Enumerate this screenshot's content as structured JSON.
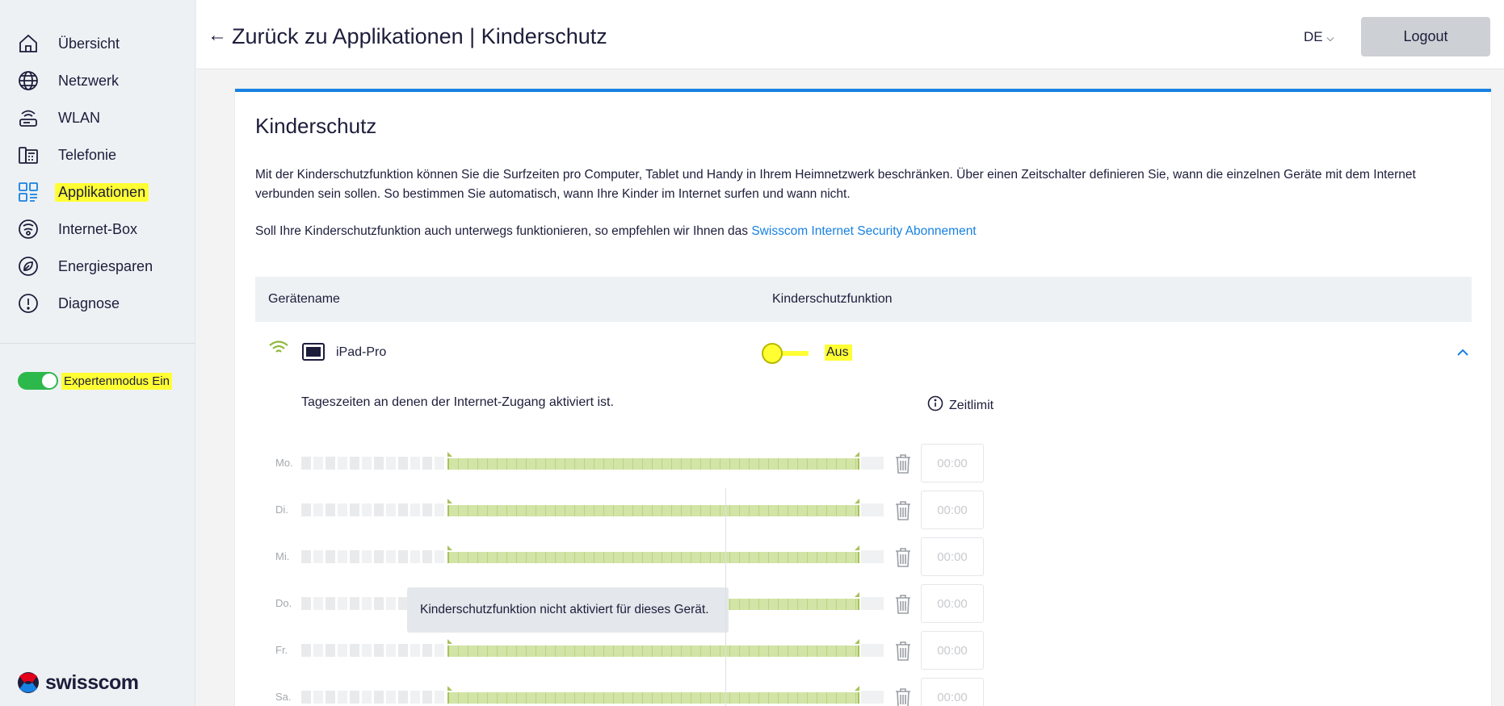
{
  "nav": {
    "items": [
      {
        "label": "Übersicht",
        "icon": "home-icon"
      },
      {
        "label": "Netzwerk",
        "icon": "globe-icon"
      },
      {
        "label": "WLAN",
        "icon": "wlan-router-icon"
      },
      {
        "label": "Telefonie",
        "icon": "phone-icon"
      },
      {
        "label": "Applikationen",
        "icon": "apps-grid-icon",
        "active": true
      },
      {
        "label": "Internet-Box",
        "icon": "internet-box-icon"
      },
      {
        "label": "Energiesparen",
        "icon": "leaf-icon"
      },
      {
        "label": "Diagnose",
        "icon": "alert-icon"
      }
    ],
    "expert_mode_label": "Expertenmodus Ein",
    "expert_mode_on": true,
    "logo_text": "swisscom"
  },
  "header": {
    "title": "Zurück zu Applikationen | Kinderschutz",
    "language": "DE",
    "logout_label": "Logout"
  },
  "card": {
    "title": "Kinderschutz",
    "description": "Mit der Kinderschutzfunktion können Sie die Surfzeiten pro Computer, Tablet und Handy in Ihrem Heimnetzwerk beschränken. Über einen Zeitschalter definieren Sie, wann die einzelnen Geräte mit dem Internet verbunden sein sollen. So bestimmen Sie automatisch, wann Ihre Kinder im Internet surfen und wann nicht.",
    "description2_prefix": "Soll Ihre Kinderschutzfunktion auch unterwegs funktionieren, so empfehlen wir Ihnen das ",
    "description2_link": "Swisscom Internet Security Abonnement",
    "table": {
      "col_device": "Gerätename",
      "col_function": "Kinderschutzfunktion"
    },
    "device": {
      "name": "iPad-Pro",
      "toggle_label": "Aus",
      "enabled": false
    },
    "schedule_label": "Tageszeiten an denen der Internet-Zugang aktiviert ist.",
    "time_limit_label": "Zeitlimit",
    "days": [
      {
        "label": "Mo.",
        "time": "00:00"
      },
      {
        "label": "Di.",
        "time": "00:00"
      },
      {
        "label": "Mi.",
        "time": "00:00"
      },
      {
        "label": "Do.",
        "time": "00:00"
      },
      {
        "label": "Fr.",
        "time": "00:00"
      },
      {
        "label": "Sa.",
        "time": "00:00"
      }
    ],
    "tooltip": "Kinderschutzfunktion nicht aktiviert für dieses Gerät."
  },
  "colors": {
    "accent": "#1781e3",
    "highlight": "#ffff33",
    "active_green": "#2db84b",
    "schedule_green": "#d2e4a6"
  }
}
